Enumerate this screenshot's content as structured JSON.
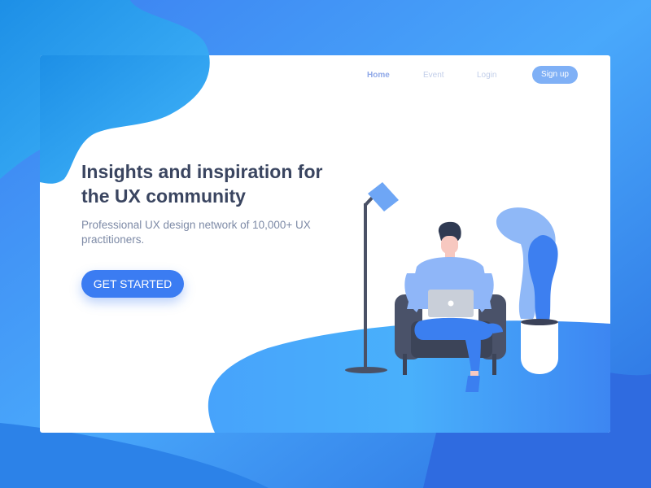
{
  "nav": {
    "links": [
      {
        "label": "Home"
      },
      {
        "label": "Event"
      },
      {
        "label": "Login"
      }
    ],
    "signup_label": "Sign up"
  },
  "hero": {
    "headline": "Insights and inspiration for the UX community",
    "subtext": "Professional UX design network of 10,000+ UX practitioners.",
    "cta_label": "GET STARTED"
  },
  "colors": {
    "accent": "#3b7cf2",
    "headline": "#3a4560",
    "body_text": "#7d8aa6",
    "nav_active": "#8fa8e8",
    "nav_inactive": "#c2cee9"
  },
  "illustration": {
    "icons": [
      "floor-lamp-icon",
      "person-with-laptop-icon",
      "armchair-icon",
      "potted-plant-icon"
    ]
  }
}
